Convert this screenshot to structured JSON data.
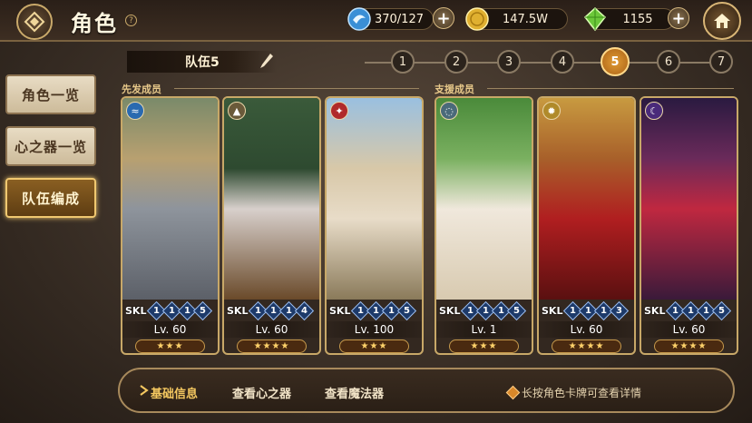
{
  "header": {
    "title": "角色",
    "help_symbol": "?",
    "stamina": "370/127",
    "gold": "147.5W",
    "gems": "1155",
    "plus_symbol": "+"
  },
  "sidebar": {
    "items": [
      {
        "label": "角色一览",
        "active": false
      },
      {
        "label": "心之器一览",
        "active": false
      },
      {
        "label": "队伍编成",
        "active": true
      }
    ]
  },
  "team": {
    "name": "队伍5",
    "tabs": [
      "1",
      "2",
      "3",
      "4",
      "5",
      "6",
      "7"
    ],
    "active_tab": "5",
    "starter_label": "先发成员",
    "support_label": "支援成员"
  },
  "cards": [
    {
      "element": "water-icon",
      "skl_label": "SKL",
      "skills": [
        "1",
        "1",
        "1",
        "5"
      ],
      "level": "Lv. 60",
      "stars": "★★★"
    },
    {
      "element": "earth-icon",
      "skl_label": "SKL",
      "skills": [
        "1",
        "1",
        "1",
        "4"
      ],
      "level": "Lv. 60",
      "stars": "★★★★"
    },
    {
      "element": "fire-icon",
      "skl_label": "SKL",
      "skills": [
        "1",
        "1",
        "1",
        "5"
      ],
      "level": "Lv. 100",
      "stars": "★★★"
    },
    {
      "element": "wind-icon",
      "skl_label": "SKL",
      "skills": [
        "1",
        "1",
        "1",
        "5"
      ],
      "level": "Lv. 1",
      "stars": "★★★"
    },
    {
      "element": "light-icon",
      "skl_label": "SKL",
      "skills": [
        "1",
        "1",
        "1",
        "3"
      ],
      "level": "Lv. 60",
      "stars": "★★★★"
    },
    {
      "element": "dark-icon",
      "skl_label": "SKL",
      "skills": [
        "1",
        "1",
        "1",
        "5"
      ],
      "level": "Lv. 60",
      "stars": "★★★★"
    }
  ],
  "bottom": {
    "tabs": [
      "基础信息",
      "查看心之器",
      "查看魔法器"
    ],
    "active_tab": "基础信息",
    "hint": "长按角色卡牌可查看详情"
  },
  "colors": {
    "accent_gold": "#f0c870",
    "active_tab": "#e09b34",
    "skill_gem": "#1d3a6a"
  }
}
